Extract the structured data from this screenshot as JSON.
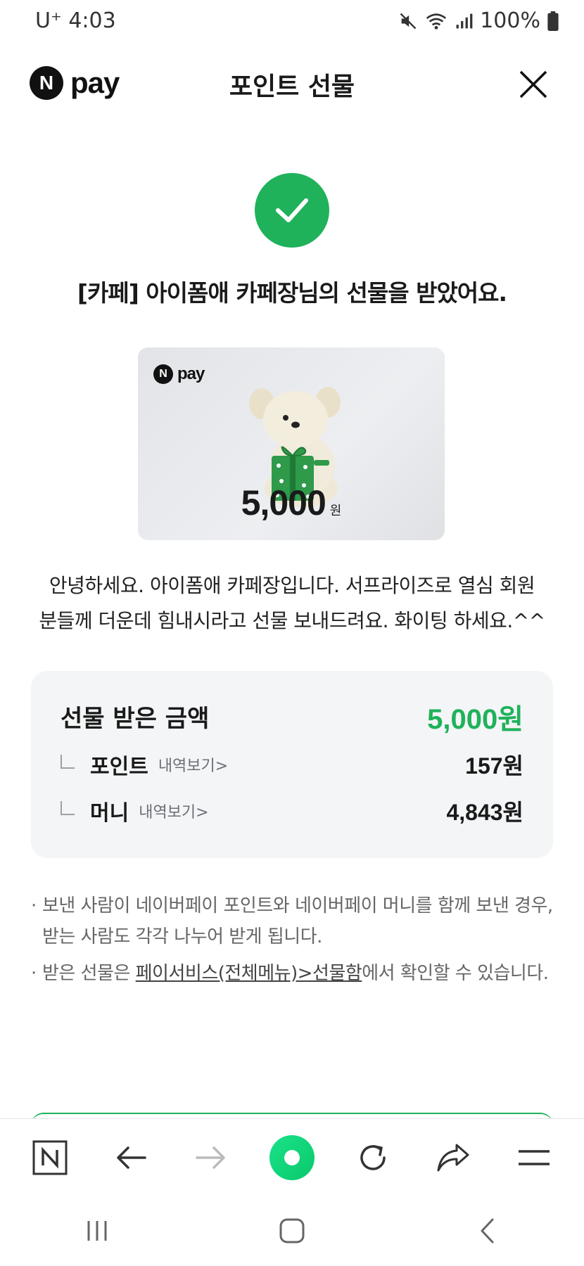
{
  "status_bar": {
    "carrier_time": "U⁺ 4:03",
    "battery": "100%"
  },
  "header": {
    "logo_n": "N",
    "logo_pay": "pay",
    "title": "포인트 선물"
  },
  "headline": "[카페] 아이폼애 카페장님의 선물을 받았어요.",
  "gift_card": {
    "logo_n": "N",
    "logo_pay": "pay",
    "amount": "5,000",
    "unit": "원"
  },
  "message_lines": [
    "안녕하세요. 아이폼애 카페장입니다. 서프라이즈로 열심 회원",
    "분들께 더운데 힘내시라고 선물 보내드려요. 화이팅 하세요.^^"
  ],
  "summary": {
    "label": "선물 받은 금액",
    "total": "5,000원",
    "rows": [
      {
        "name": "포인트",
        "link": "내역보기>",
        "value": "157원"
      },
      {
        "name": "머니",
        "link": "내역보기>",
        "value": "4,843원"
      }
    ]
  },
  "notes": {
    "note1": "보낸 사람이 네이버페이 포인트와 네이버페이 머니를 함께 보낸 경우, 받는 사람도 각각 나누어 받게 됩니다.",
    "note2_pre": "받은 선물은 ",
    "note2_link": "페이서비스(전체메뉴)>선물함",
    "note2_post": "에서 확인할 수 있습니다."
  },
  "colors": {
    "accent_green": "#1fb25a",
    "box_bg": "#f4f5f7"
  }
}
